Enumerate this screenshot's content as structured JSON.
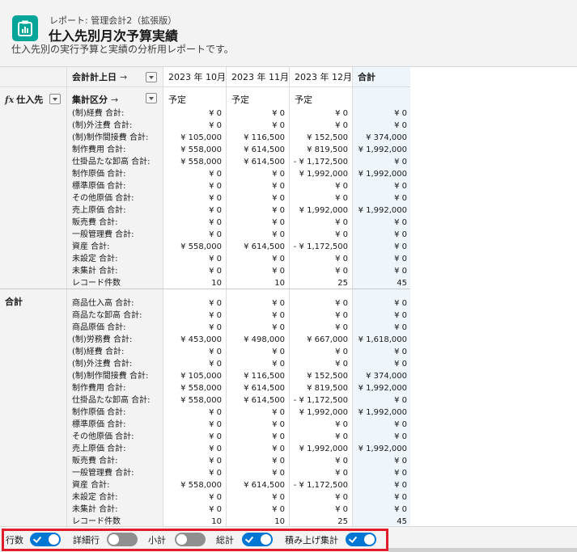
{
  "header": {
    "breadcrumb": "レポート: 管理会計2（拡張版）",
    "title": "仕入先別月次予算実績",
    "description": "仕入先別の実行予算と実績の分析用レポートです。"
  },
  "table": {
    "row_group_field": "仕入先",
    "col_field_1": "会計計上日",
    "col_field_2": "集計区分",
    "arrow": "→",
    "columns": [
      "2023 年 10月",
      "2023 年 11月",
      "2023 年 12月",
      "合計"
    ],
    "sub_headers": [
      "予定",
      "予定",
      "予定",
      ""
    ],
    "groups": [
      {
        "label": "",
        "rows": [
          {
            "label": "(制)経費 合計:",
            "values": [
              "¥ 0",
              "¥ 0",
              "¥ 0",
              "¥ 0"
            ]
          },
          {
            "label": "(制)外注費 合計:",
            "values": [
              "¥ 0",
              "¥ 0",
              "¥ 0",
              "¥ 0"
            ]
          },
          {
            "label": "(制)制作間接費 合計:",
            "values": [
              "¥ 105,000",
              "¥ 116,500",
              "¥ 152,500",
              "¥ 374,000"
            ]
          },
          {
            "label": "制作費用 合計:",
            "values": [
              "¥ 558,000",
              "¥ 614,500",
              "¥ 819,500",
              "¥ 1,992,000"
            ]
          },
          {
            "label": "仕掛品たな卸高 合計:",
            "values": [
              "¥ 558,000",
              "¥ 614,500",
              "- ¥ 1,172,500",
              "¥ 0"
            ]
          },
          {
            "label": "制作原価 合計:",
            "values": [
              "¥ 0",
              "¥ 0",
              "¥ 1,992,000",
              "¥ 1,992,000"
            ]
          },
          {
            "label": "標準原価 合計:",
            "values": [
              "¥ 0",
              "¥ 0",
              "¥ 0",
              "¥ 0"
            ]
          },
          {
            "label": "その他原価 合計:",
            "values": [
              "¥ 0",
              "¥ 0",
              "¥ 0",
              "¥ 0"
            ]
          },
          {
            "label": "売上原価 合計:",
            "values": [
              "¥ 0",
              "¥ 0",
              "¥ 1,992,000",
              "¥ 1,992,000"
            ]
          },
          {
            "label": "販売費 合計:",
            "values": [
              "¥ 0",
              "¥ 0",
              "¥ 0",
              "¥ 0"
            ]
          },
          {
            "label": "一般管理費 合計:",
            "values": [
              "¥ 0",
              "¥ 0",
              "¥ 0",
              "¥ 0"
            ]
          },
          {
            "label": "資産 合計:",
            "values": [
              "¥ 558,000",
              "¥ 614,500",
              "- ¥ 1,172,500",
              "¥ 0"
            ]
          },
          {
            "label": "未設定 合計:",
            "values": [
              "¥ 0",
              "¥ 0",
              "¥ 0",
              "¥ 0"
            ]
          },
          {
            "label": "未集計 合計:",
            "values": [
              "¥ 0",
              "¥ 0",
              "¥ 0",
              "¥ 0"
            ]
          },
          {
            "label": "レコード件数",
            "values": [
              "10",
              "10",
              "25",
              "45"
            ]
          }
        ]
      },
      {
        "label": "合計",
        "rows": [
          {
            "label": "商品仕入高 合計:",
            "values": [
              "¥ 0",
              "¥ 0",
              "¥ 0",
              "¥ 0"
            ]
          },
          {
            "label": "商品たな卸高 合計:",
            "values": [
              "¥ 0",
              "¥ 0",
              "¥ 0",
              "¥ 0"
            ]
          },
          {
            "label": "商品原価 合計:",
            "values": [
              "¥ 0",
              "¥ 0",
              "¥ 0",
              "¥ 0"
            ]
          },
          {
            "label": "(制)労務費 合計:",
            "values": [
              "¥ 453,000",
              "¥ 498,000",
              "¥ 667,000",
              "¥ 1,618,000"
            ]
          },
          {
            "label": "(制)経費 合計:",
            "values": [
              "¥ 0",
              "¥ 0",
              "¥ 0",
              "¥ 0"
            ]
          },
          {
            "label": "(制)外注費 合計:",
            "values": [
              "¥ 0",
              "¥ 0",
              "¥ 0",
              "¥ 0"
            ]
          },
          {
            "label": "(制)制作間接費 合計:",
            "values": [
              "¥ 105,000",
              "¥ 116,500",
              "¥ 152,500",
              "¥ 374,000"
            ]
          },
          {
            "label": "制作費用 合計:",
            "values": [
              "¥ 558,000",
              "¥ 614,500",
              "¥ 819,500",
              "¥ 1,992,000"
            ]
          },
          {
            "label": "仕掛品たな卸高 合計:",
            "values": [
              "¥ 558,000",
              "¥ 614,500",
              "- ¥ 1,172,500",
              "¥ 0"
            ]
          },
          {
            "label": "制作原価 合計:",
            "values": [
              "¥ 0",
              "¥ 0",
              "¥ 1,992,000",
              "¥ 1,992,000"
            ]
          },
          {
            "label": "標準原価 合計:",
            "values": [
              "¥ 0",
              "¥ 0",
              "¥ 0",
              "¥ 0"
            ]
          },
          {
            "label": "その他原価 合計:",
            "values": [
              "¥ 0",
              "¥ 0",
              "¥ 0",
              "¥ 0"
            ]
          },
          {
            "label": "売上原価 合計:",
            "values": [
              "¥ 0",
              "¥ 0",
              "¥ 1,992,000",
              "¥ 1,992,000"
            ]
          },
          {
            "label": "販売費 合計:",
            "values": [
              "¥ 0",
              "¥ 0",
              "¥ 0",
              "¥ 0"
            ]
          },
          {
            "label": "一般管理費 合計:",
            "values": [
              "¥ 0",
              "¥ 0",
              "¥ 0",
              "¥ 0"
            ]
          },
          {
            "label": "資産 合計:",
            "values": [
              "¥ 558,000",
              "¥ 614,500",
              "- ¥ 1,172,500",
              "¥ 0"
            ]
          },
          {
            "label": "未設定 合計:",
            "values": [
              "¥ 0",
              "¥ 0",
              "¥ 0",
              "¥ 0"
            ]
          },
          {
            "label": "未集計 合計:",
            "values": [
              "¥ 0",
              "¥ 0",
              "¥ 0",
              "¥ 0"
            ]
          },
          {
            "label": "レコード件数",
            "values": [
              "10",
              "10",
              "25",
              "45"
            ]
          }
        ]
      }
    ]
  },
  "footer": {
    "toggles": [
      {
        "label": "行数",
        "on": true
      },
      {
        "label": "詳細行",
        "on": false
      },
      {
        "label": "小計",
        "on": false
      },
      {
        "label": "総計",
        "on": true
      },
      {
        "label": "積み上げ集計",
        "on": true
      }
    ]
  },
  "colors": {
    "accent": "#0176d3",
    "app_icon": "#06a59a",
    "highlight_outline": "#e11d2a",
    "total_column": "#eef5fb"
  }
}
